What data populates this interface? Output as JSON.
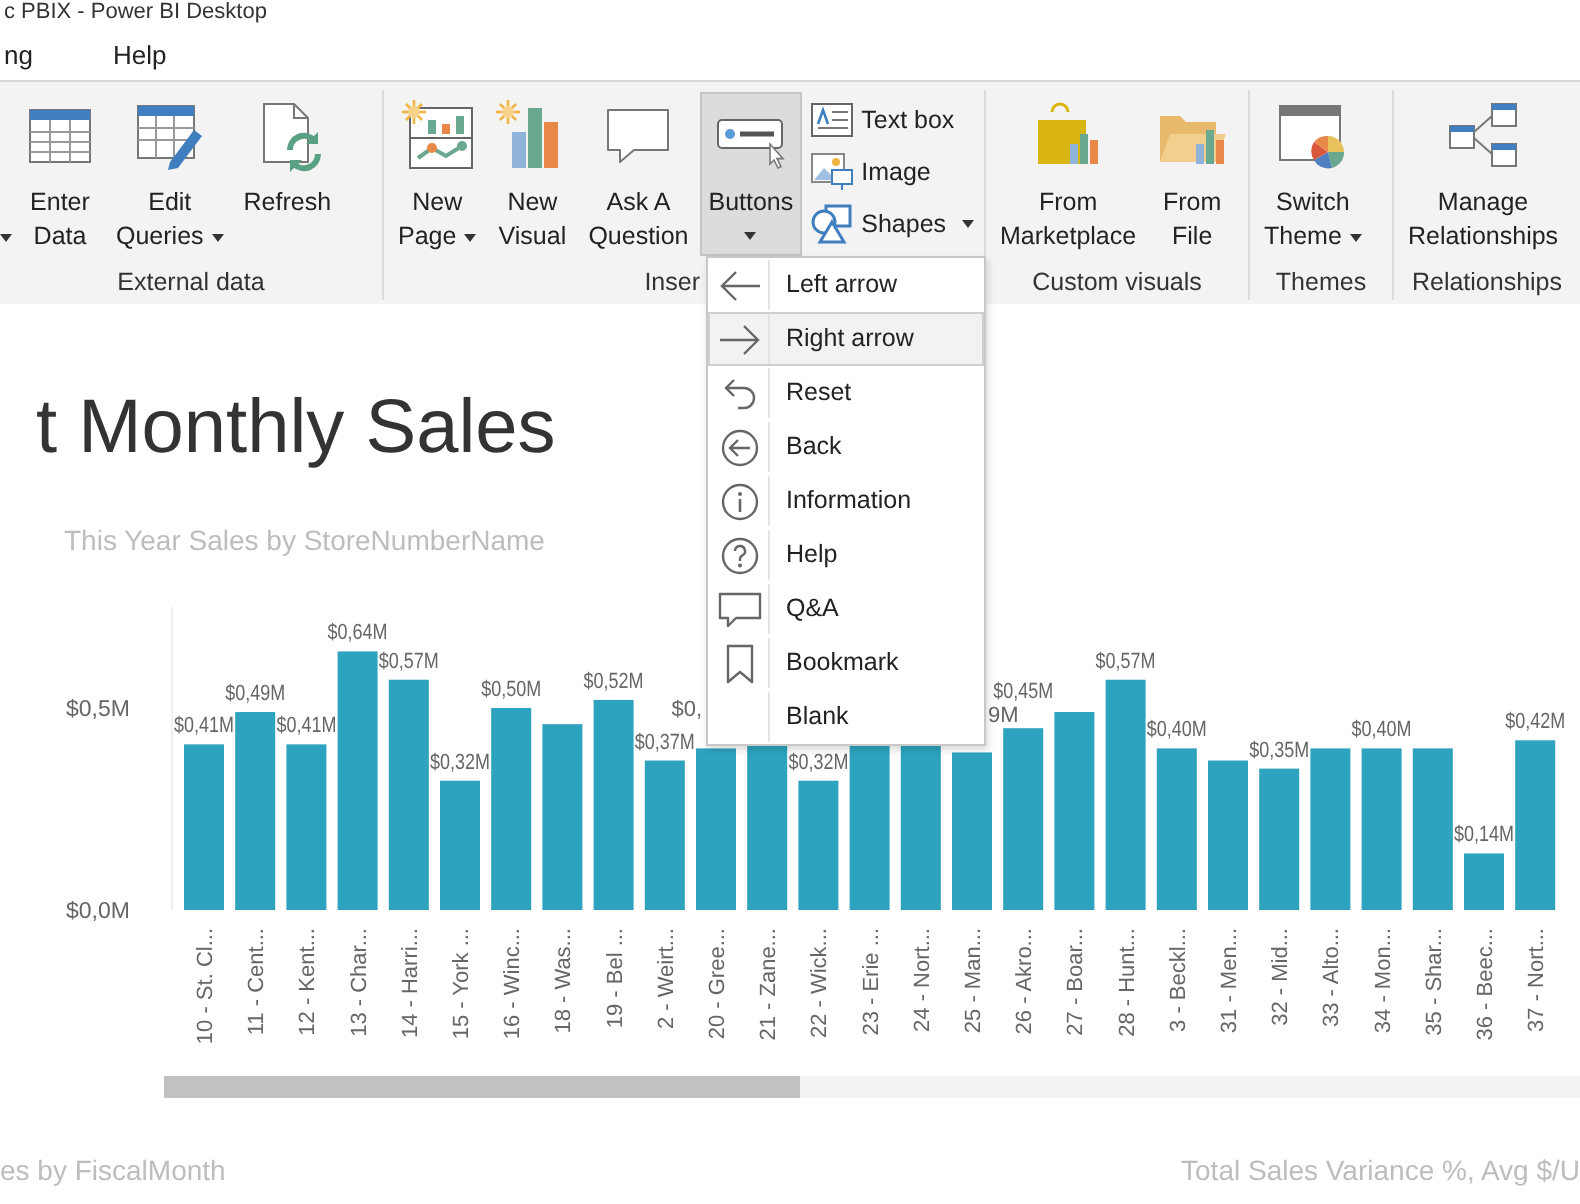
{
  "window": {
    "title": "c PBIX - Power BI Desktop"
  },
  "menu": [
    {
      "label": "ng"
    },
    {
      "label": "Help"
    }
  ],
  "ribbon": {
    "groups": [
      {
        "label": "External data",
        "buttons": [
          {
            "lines": [
              "Enter",
              "Data"
            ],
            "dropdown": false,
            "pressed": false
          },
          {
            "lines": [
              "Edit",
              "Queries"
            ],
            "dropdown": true,
            "pressed": false
          },
          {
            "lines": [
              "Refresh"
            ],
            "dropdown": false,
            "pressed": false
          }
        ]
      },
      {
        "label": "Inser",
        "buttons": [
          {
            "lines": [
              "New",
              "Page"
            ],
            "dropdown": true,
            "pressed": false
          },
          {
            "lines": [
              "New",
              "Visual"
            ],
            "dropdown": false,
            "pressed": false
          },
          {
            "lines": [
              "Ask A",
              "Question"
            ],
            "dropdown": false,
            "pressed": false
          },
          {
            "lines": [
              "Buttons"
            ],
            "dropdown": true,
            "pressed": true
          }
        ],
        "small_buttons": [
          {
            "label": "Text box",
            "dropdown": false
          },
          {
            "label": "Image",
            "dropdown": false
          },
          {
            "label": "Shapes",
            "dropdown": true
          }
        ]
      },
      {
        "label": "Custom visuals",
        "buttons": [
          {
            "lines": [
              "From",
              "Marketplace"
            ],
            "dropdown": false,
            "pressed": false
          },
          {
            "lines": [
              "From",
              "File"
            ],
            "dropdown": false,
            "pressed": false
          }
        ]
      },
      {
        "label": "Themes",
        "buttons": [
          {
            "lines": [
              "Switch",
              "Theme"
            ],
            "dropdown": true,
            "pressed": false
          }
        ]
      },
      {
        "label": "Relationships",
        "buttons": [
          {
            "lines": [
              "Manage",
              "Relationships"
            ],
            "dropdown": false,
            "pressed": false
          }
        ]
      }
    ]
  },
  "dropdown": {
    "items": [
      {
        "label": "Left arrow",
        "selected": false
      },
      {
        "label": "Right arrow",
        "selected": true
      },
      {
        "label": "Reset",
        "selected": false
      },
      {
        "label": "Back",
        "selected": false
      },
      {
        "label": "Information",
        "selected": false
      },
      {
        "label": "Help",
        "selected": false
      },
      {
        "label": "Q&A",
        "selected": false
      },
      {
        "label": "Bookmark",
        "selected": false
      },
      {
        "label": "Blank",
        "selected": false
      }
    ]
  },
  "report": {
    "title": "t Monthly Sales",
    "chart_data": {
      "type": "bar",
      "title": "This Year Sales by StoreNumberName",
      "categories": [
        "10 - St. Cl...",
        "11 - Cent...",
        "12 - Kent...",
        "13 - Char...",
        "14 - Harri...",
        "15 - York ...",
        "16 - Winc...",
        "18 - Was...",
        "19 - Bel ...",
        "2 - Weirt...",
        "20 - Gree...",
        "21 - Zane...",
        "22 - Wick...",
        "23 - Erie ...",
        "24 - Nort...",
        "25 - Man...",
        "26 - Akro...",
        "27 - Boar...",
        "28 - Hunt...",
        "3 - Beckl...",
        "31 - Men...",
        "32 - Mid...",
        "33 - Alto...",
        "34 - Mon...",
        "35 - Shar...",
        "36 - Beec...",
        "37 - Nort..."
      ],
      "values": [
        0.41,
        0.49,
        0.41,
        0.64,
        0.57,
        0.32,
        0.5,
        0.46,
        0.52,
        0.37,
        0.4,
        0.41,
        0.32,
        0.41,
        0.41,
        0.39,
        0.45,
        0.49,
        0.57,
        0.4,
        0.37,
        0.35,
        0.4,
        0.4,
        0.4,
        0.14,
        0.42
      ],
      "value_labels": [
        "$0,41M",
        "$0,49M",
        "$0,41M",
        "$0,64M",
        "$0,57M",
        "$0,32M",
        "$0,50M",
        null,
        "$0,52M",
        "$0,37M",
        null,
        null,
        "$0,32M",
        null,
        null,
        null,
        "$0,45M",
        null,
        "$0,57M",
        "$0,40M",
        null,
        "$0,35M",
        null,
        "$0,40M",
        null,
        "$0,14M",
        "$0,42M"
      ],
      "ylim": [
        0,
        0.75
      ],
      "yticks": [
        {
          "value": 0,
          "label": "$0,0M"
        },
        {
          "value": 0.5,
          "label": "$0,5M"
        }
      ]
    },
    "covered_labels": [
      {
        "text": "$0,"
      },
      {
        "text": "9M"
      }
    ],
    "footer_titles": [
      "es by FiscalMonth",
      "Total Sales Variance %, Avg $/U"
    ]
  }
}
